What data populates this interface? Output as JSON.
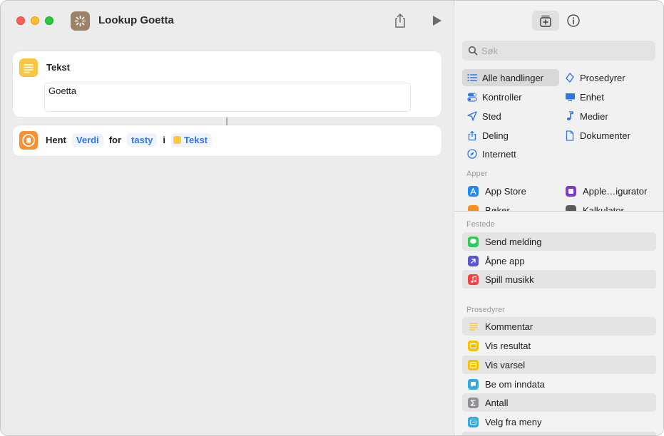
{
  "window": {
    "title": "Lookup Goetta"
  },
  "editor": {
    "text_action": {
      "title": "Tekst",
      "value": "Goetta"
    },
    "get_action": {
      "word_get": "Hent",
      "param_value": "Verdi",
      "word_for": "for",
      "param_key": "tasty",
      "word_in": "i",
      "param_source": "Tekst"
    }
  },
  "sidebar": {
    "search": {
      "placeholder": "Søk",
      "value": ""
    },
    "categories": [
      {
        "label": "Alle handlinger",
        "icon": "list-icon",
        "selected": true
      },
      {
        "label": "Prosedyrer",
        "icon": "scripting-icon"
      },
      {
        "label": "Kontroller",
        "icon": "controls-icon"
      },
      {
        "label": "Enhet",
        "icon": "device-icon"
      },
      {
        "label": "Sted",
        "icon": "location-icon"
      },
      {
        "label": "Medier",
        "icon": "music-note-icon"
      },
      {
        "label": "Deling",
        "icon": "share-icon"
      },
      {
        "label": "Dokumenter",
        "icon": "document-icon"
      },
      {
        "label": "Internett",
        "icon": "safari-icon"
      }
    ],
    "apps_header": "Apper",
    "apps": [
      {
        "label": "App Store",
        "icon": "app-store-icon",
        "color": "#1b8cf5"
      },
      {
        "label": "Apple…igurator",
        "icon": "configurator-icon",
        "color": "#7a3fc9"
      },
      {
        "label": "Bøker",
        "icon": "books-icon",
        "color": "#f7901e"
      },
      {
        "label": "Kalkulator",
        "icon": "calculator-icon",
        "color": "#5a5a5a"
      }
    ],
    "pinned_header": "Festede",
    "pinned": [
      {
        "label": "Send melding",
        "icon": "messages-icon",
        "color": "#34c759"
      },
      {
        "label": "Åpne app",
        "icon": "open-app-icon",
        "color": "#5856d6"
      },
      {
        "label": "Spill musikk",
        "icon": "music-icon",
        "color": "#fc3c44"
      }
    ],
    "scripting_header": "Prosedyrer",
    "scripting": [
      {
        "label": "Kommentar",
        "icon": "comment-icon",
        "color": "#f7c840"
      },
      {
        "label": "Vis resultat",
        "icon": "show-result-icon",
        "color": "#f7c000"
      },
      {
        "label": "Vis varsel",
        "icon": "alert-icon",
        "color": "#f7c000"
      },
      {
        "label": "Be om inndata",
        "icon": "ask-input-icon",
        "color": "#34aadc"
      },
      {
        "label": "Antall",
        "icon": "sigma-icon",
        "color": "#8e8e93"
      },
      {
        "label": "Velg fra meny",
        "icon": "menu-icon",
        "color": "#34aadc"
      }
    ]
  }
}
